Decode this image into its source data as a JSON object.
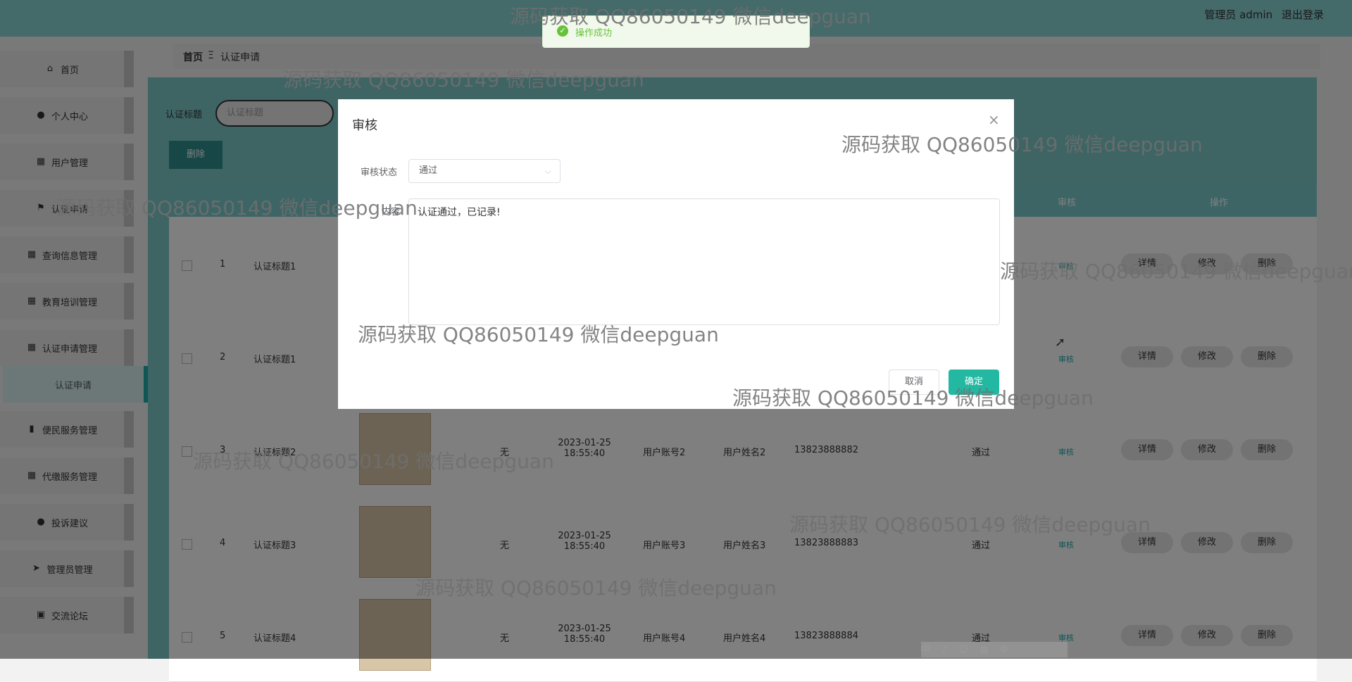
{
  "header": {
    "user_label": "管理员 admin",
    "logout_label": "退出登录"
  },
  "sidebar": {
    "items": [
      {
        "label": "首页",
        "icon": "home-icon",
        "glyph": "⌂"
      },
      {
        "label": "个人中心",
        "icon": "user-icon",
        "glyph": "●"
      },
      {
        "label": "用户管理",
        "icon": "grid-icon",
        "glyph": "▦"
      },
      {
        "label": "认证申请",
        "icon": "flag-icon",
        "glyph": "⚑"
      },
      {
        "label": "查询信息管理",
        "icon": "grid-icon",
        "glyph": "▦"
      },
      {
        "label": "教育培训管理",
        "icon": "grid-icon",
        "glyph": "▦"
      },
      {
        "label": "认证申请管理",
        "icon": "grid-icon",
        "glyph": "▦"
      },
      {
        "label": "认证申请",
        "icon": "",
        "glyph": ""
      },
      {
        "label": "便民服务管理",
        "icon": "chart-icon",
        "glyph": "▮"
      },
      {
        "label": "代缴服务管理",
        "icon": "grid-icon",
        "glyph": "▦"
      },
      {
        "label": "投诉建议",
        "icon": "user-icon",
        "glyph": "●"
      },
      {
        "label": "管理员管理",
        "icon": "send-icon",
        "glyph": "➤"
      },
      {
        "label": "交流论坛",
        "icon": "clipboard-icon",
        "glyph": "▣"
      }
    ]
  },
  "breadcrumb": {
    "home": "首页",
    "separator": "Ξ",
    "current": "认证申请"
  },
  "search": {
    "label": "认证标题",
    "placeholder": "认证标题"
  },
  "toolbar": {
    "delete_label": "删除"
  },
  "table": {
    "headers": {
      "audit": "审核",
      "actions": "操作"
    },
    "rows": [
      {
        "index": "1",
        "title": "认证标题1",
        "result": "",
        "time": "",
        "account": "",
        "name": "",
        "phone": "",
        "status": ""
      },
      {
        "index": "2",
        "title": "认证标题1",
        "result": "",
        "time": "",
        "account": "",
        "name": "",
        "phone": "",
        "status": ""
      },
      {
        "index": "3",
        "title": "认证标题2",
        "result": "无",
        "time": "2023-01-25 18:55:40",
        "account": "用户账号2",
        "name": "用户姓名2",
        "phone": "13823888882",
        "status": "通过"
      },
      {
        "index": "4",
        "title": "认证标题3",
        "result": "无",
        "time": "2023-01-25 18:55:40",
        "account": "用户账号3",
        "name": "用户姓名3",
        "phone": "13823888883",
        "status": "通过"
      },
      {
        "index": "5",
        "title": "认证标题4",
        "result": "无",
        "time": "2023-01-25 18:55:40",
        "account": "用户账号4",
        "name": "用户姓名4",
        "phone": "13823888884",
        "status": "通过"
      }
    ],
    "audit_link": "审核",
    "detail_label": "详情",
    "edit_label": "修改",
    "delete_label": "删除"
  },
  "dialog": {
    "title": "审核",
    "status_label": "审核状态",
    "status_value": "通过",
    "content_label": "内容",
    "content_value": "认证通过，已记录!",
    "cancel_label": "取消",
    "ok_label": "确定"
  },
  "toast": {
    "message": "操作成功"
  },
  "watermark": "源码获取 QQ86050149 微信deepguan",
  "colors": {
    "accent": "#23b8a2",
    "header_bg": "#8ad4d4",
    "success": "#67c23a"
  }
}
